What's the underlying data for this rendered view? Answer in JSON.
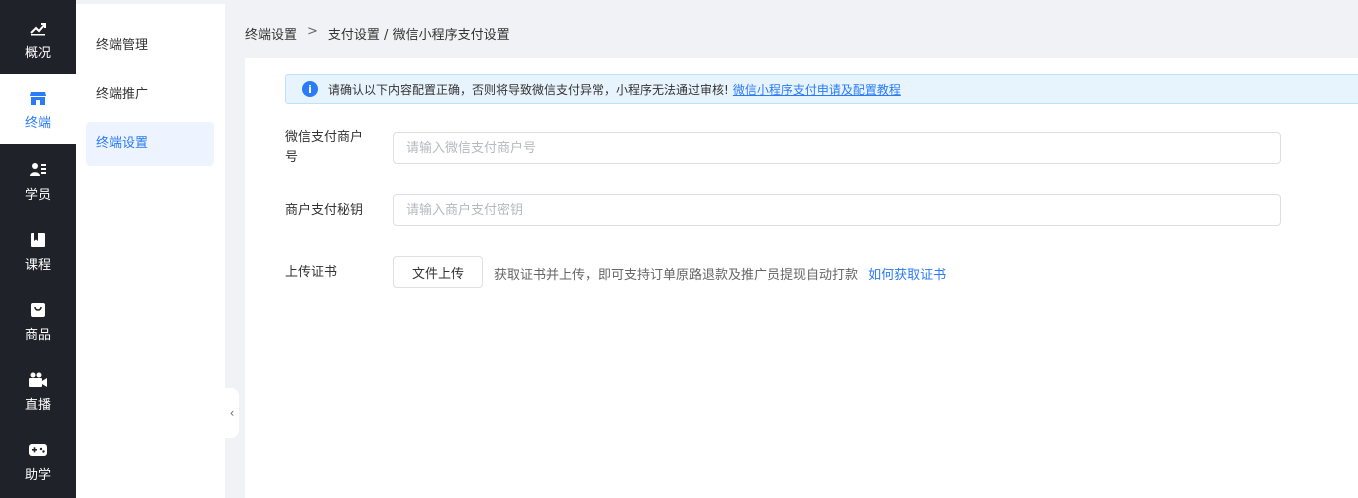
{
  "nav": {
    "items": [
      {
        "label": "概况",
        "icon": "chart-up-icon"
      },
      {
        "label": "终端",
        "icon": "store-icon"
      },
      {
        "label": "学员",
        "icon": "users-icon"
      },
      {
        "label": "课程",
        "icon": "book-icon"
      },
      {
        "label": "商品",
        "icon": "bag-icon"
      },
      {
        "label": "直播",
        "icon": "video-icon"
      },
      {
        "label": "助学",
        "icon": "gamepad-icon"
      }
    ],
    "active_index": 1,
    "accent": "#2a7bf6"
  },
  "submenu": {
    "items": [
      {
        "label": "终端管理"
      },
      {
        "label": "终端推广"
      },
      {
        "label": "终端设置"
      }
    ],
    "active_index": 2
  },
  "breadcrumb": {
    "root": "终端设置",
    "separator": ">",
    "current": "支付设置 / 微信小程序支付设置"
  },
  "alert": {
    "icon": "info-icon",
    "message": "请确认以下内容配置正确，否则将导致微信支付异常，小程序无法通过审核!",
    "link_text": "微信小程序支付申请及配置教程"
  },
  "form": {
    "merchant_id_label": "微信支付商户号",
    "merchant_id_placeholder": "请输入微信支付商户号",
    "merchant_id_value": "",
    "secret_label": "商户支付秘钥",
    "secret_placeholder": "请输入商户支付密钥",
    "secret_value": "",
    "cert_label": "上传证书",
    "upload_button": "文件上传",
    "upload_hint": "获取证书并上传，即可支持订单原路退款及推广员提现自动打款",
    "upload_help_link": "如何获取证书"
  }
}
